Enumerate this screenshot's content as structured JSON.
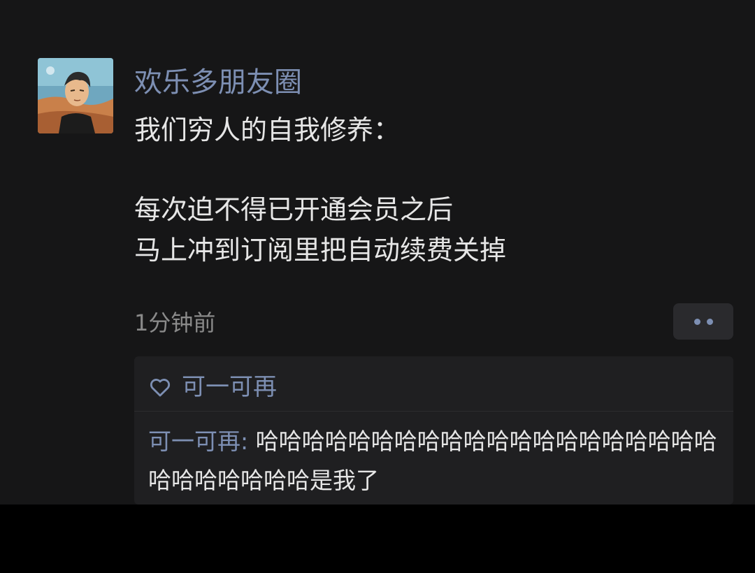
{
  "post": {
    "author": "欢乐多朋友圈",
    "lines": [
      "我们穷人的自我修养：",
      "每次迫不得已开通会员之后",
      "马上冲到订阅里把自动续费关掉"
    ],
    "timestamp": "1分钟前"
  },
  "icons": {
    "avatar": "anime-character-avatar",
    "like": "heart-outline-icon",
    "more": "more-dots-icon"
  },
  "likes": {
    "names": "可一可再"
  },
  "comments": [
    {
      "author": "可一可再",
      "separator": ": ",
      "text": "哈哈哈哈哈哈哈哈哈哈哈哈哈哈哈哈哈哈哈哈哈哈哈哈哈哈哈是我了"
    }
  ],
  "colors": {
    "background": "#161617",
    "name_blue": "#7d8fb3",
    "text": "#e6e6e6",
    "secondary": "#8a8a8a",
    "panel": "#1f1f21"
  }
}
